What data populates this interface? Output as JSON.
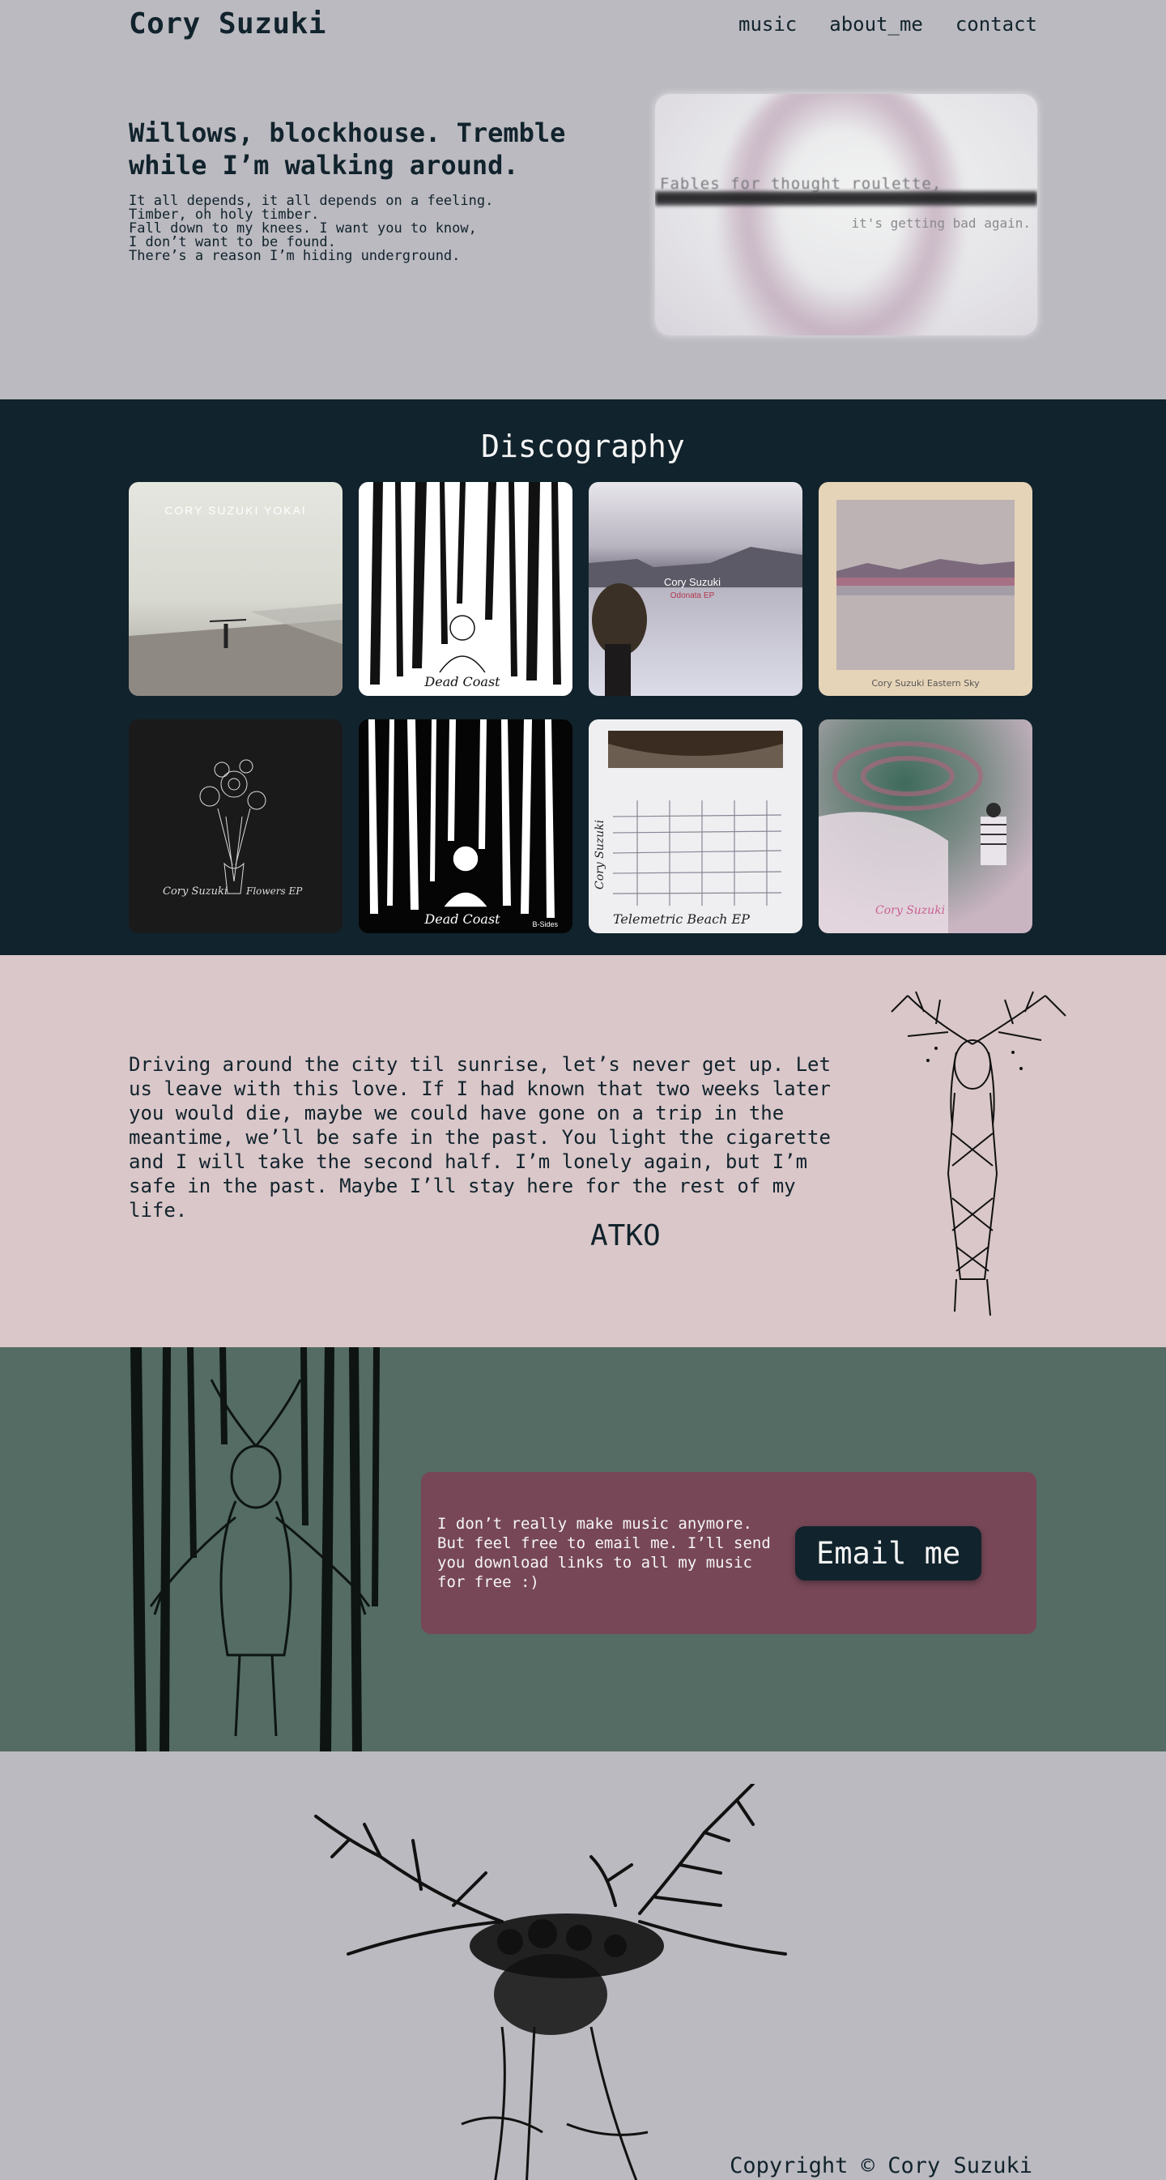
{
  "header": {
    "site_title": "Cory Suzuki",
    "nav": [
      "music",
      "about_me",
      "contact"
    ]
  },
  "hero": {
    "heading": "Willows, blockhouse. Tremble while I’m walking around.",
    "lyrics": [
      "It all depends, it all depends on a feeling.",
      "Timber, oh holy timber.",
      "Fall down to my knees. I want you to know,",
      "I don’t want to be found.",
      "There’s a reason I’m hiding underground."
    ],
    "video": {
      "text_top": "Fables for thought roulette,",
      "text_bottom": "it's getting bad again."
    }
  },
  "discography": {
    "title": "Discography",
    "albums": [
      {
        "cover_text": "CORY SUZUKI YOKAI",
        "name": "yokai-cover"
      },
      {
        "cover_text": "Dead Coast",
        "name": "dead-coast-cover"
      },
      {
        "cover_text": "Cory Suzuki",
        "cover_subtext": "Odonata EP",
        "name": "odonata-cover"
      },
      {
        "cover_text": "Cory Suzuki  Eastern Sky",
        "name": "eastern-sky-cover"
      },
      {
        "cover_text": "Cory Suzuki",
        "cover_subtext": "Flowers EP",
        "name": "flowers-cover"
      },
      {
        "cover_text": "Dead Coast",
        "cover_subtext": "B-Sides",
        "name": "dead-coast-bsides-cover"
      },
      {
        "cover_text": "Telemetric Beach EP",
        "cover_side": "Cory Suzuki",
        "name": "telemetric-beach-cover"
      },
      {
        "cover_text": "Cory Suzuki",
        "name": "swirl-cover"
      }
    ]
  },
  "quote": {
    "text": "Driving around the city til sunrise, let’s never get up. Let us leave with this love. If I had known that two weeks later you would die, maybe we could have gone on a trip in the meantime, we’ll be safe in the past. You light the cigarette and I will take the second half. I’m lonely again, but I’m safe in the past. Maybe I’ll stay here for the rest of my life.",
    "author": "ATKO"
  },
  "contact": {
    "text": "I don’t really make music anymore. But feel free to email me. I’ll send you download links to all my music for free :)",
    "button_label": "Email me"
  },
  "footer": {
    "copyright": "Copyright © Cory Suzuki"
  },
  "colors": {
    "hero_bg": "#bbbac0",
    "disco_bg": "#11232c",
    "quote_bg": "#dac7c9",
    "contact_bg": "#546c63",
    "card_bg": "#774757",
    "text_dark": "#11232c"
  }
}
